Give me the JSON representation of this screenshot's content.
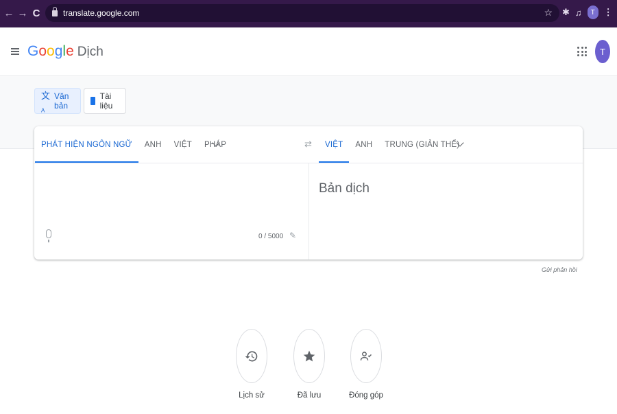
{
  "browser": {
    "back": "←",
    "forward": "→",
    "reload": "C",
    "url": "translate.google.com",
    "star": "☆",
    "profile_initial": "T",
    "menu_dots": "⋮"
  },
  "header": {
    "logo": [
      "G",
      "o",
      "o",
      "g",
      "l",
      "e"
    ],
    "product": "Dịch",
    "avatar_initial": "T"
  },
  "modes": [
    {
      "label": "Văn bản",
      "icon": "translate-icon"
    },
    {
      "label": "Tài liệu",
      "icon": "document-icon"
    }
  ],
  "source_langs": [
    "PHÁT HIỆN NGÔN NGỮ",
    "ANH",
    "VIỆT",
    "PHÁP"
  ],
  "target_langs": [
    "VIỆT",
    "ANH",
    "TRUNG (GIẢN THỂ)"
  ],
  "source": {
    "char_count": "0 / 5000"
  },
  "target": {
    "placeholder": "Bản dịch"
  },
  "feedback": "Gửi phản hồi",
  "actions": [
    {
      "label": "Lịch sử",
      "icon": "history-icon"
    },
    {
      "label": "Đã lưu",
      "icon": "star-icon"
    },
    {
      "label": "Đóng góp",
      "icon": "community-icon"
    }
  ],
  "colors": {
    "accent": "#1a73e8",
    "chrome": "#35194a"
  }
}
